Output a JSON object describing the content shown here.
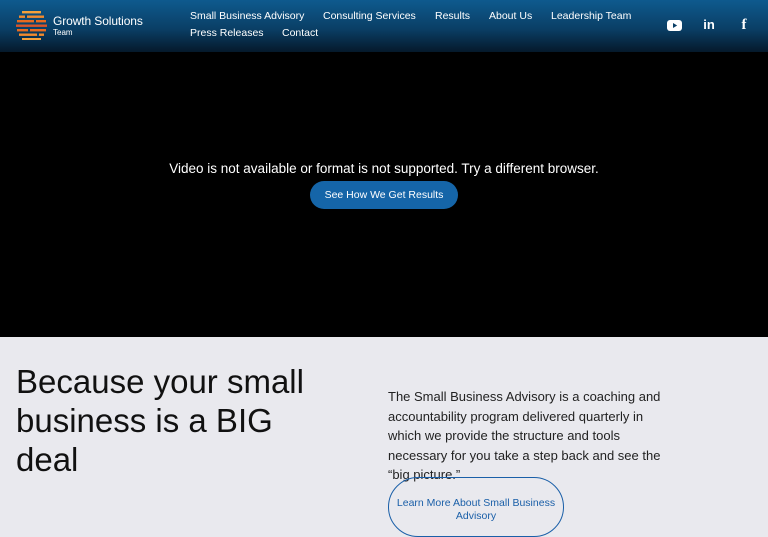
{
  "header": {
    "logo": {
      "name": "Growth Solutions",
      "tagline": "Team",
      "colors": [
        "#f28a2e",
        "#e86a1f",
        "#d9542a",
        "#f6a13a"
      ]
    },
    "nav": [
      {
        "label": "Small Business Advisory"
      },
      {
        "label": "Consulting Services"
      },
      {
        "label": "Results"
      },
      {
        "label": "About Us"
      },
      {
        "label": "Leadership Team"
      },
      {
        "label": "Press Releases"
      },
      {
        "label": "Contact"
      }
    ],
    "social": [
      {
        "icon": "youtube-icon"
      },
      {
        "icon": "linkedin-icon",
        "glyph": "in"
      },
      {
        "icon": "facebook-icon",
        "glyph": "f"
      }
    ]
  },
  "video": {
    "message": "Video is not available or format is not supported. Try a different browser.",
    "cta_label": "See How We Get Results"
  },
  "intro": {
    "headline": "Because your small business is a BIG deal",
    "description": "The Small Business Advisory is a coaching and accountability program delivered quarterly in which we provide the structure and tools necessary for you take a step back and see the “big picture.”",
    "button_label": "Learn More About Small Business Advisory"
  },
  "colors": {
    "header_top": "#0e5a8e",
    "header_bottom": "#05192b",
    "accent": "#1565a8",
    "background": "#e9e9ee"
  }
}
